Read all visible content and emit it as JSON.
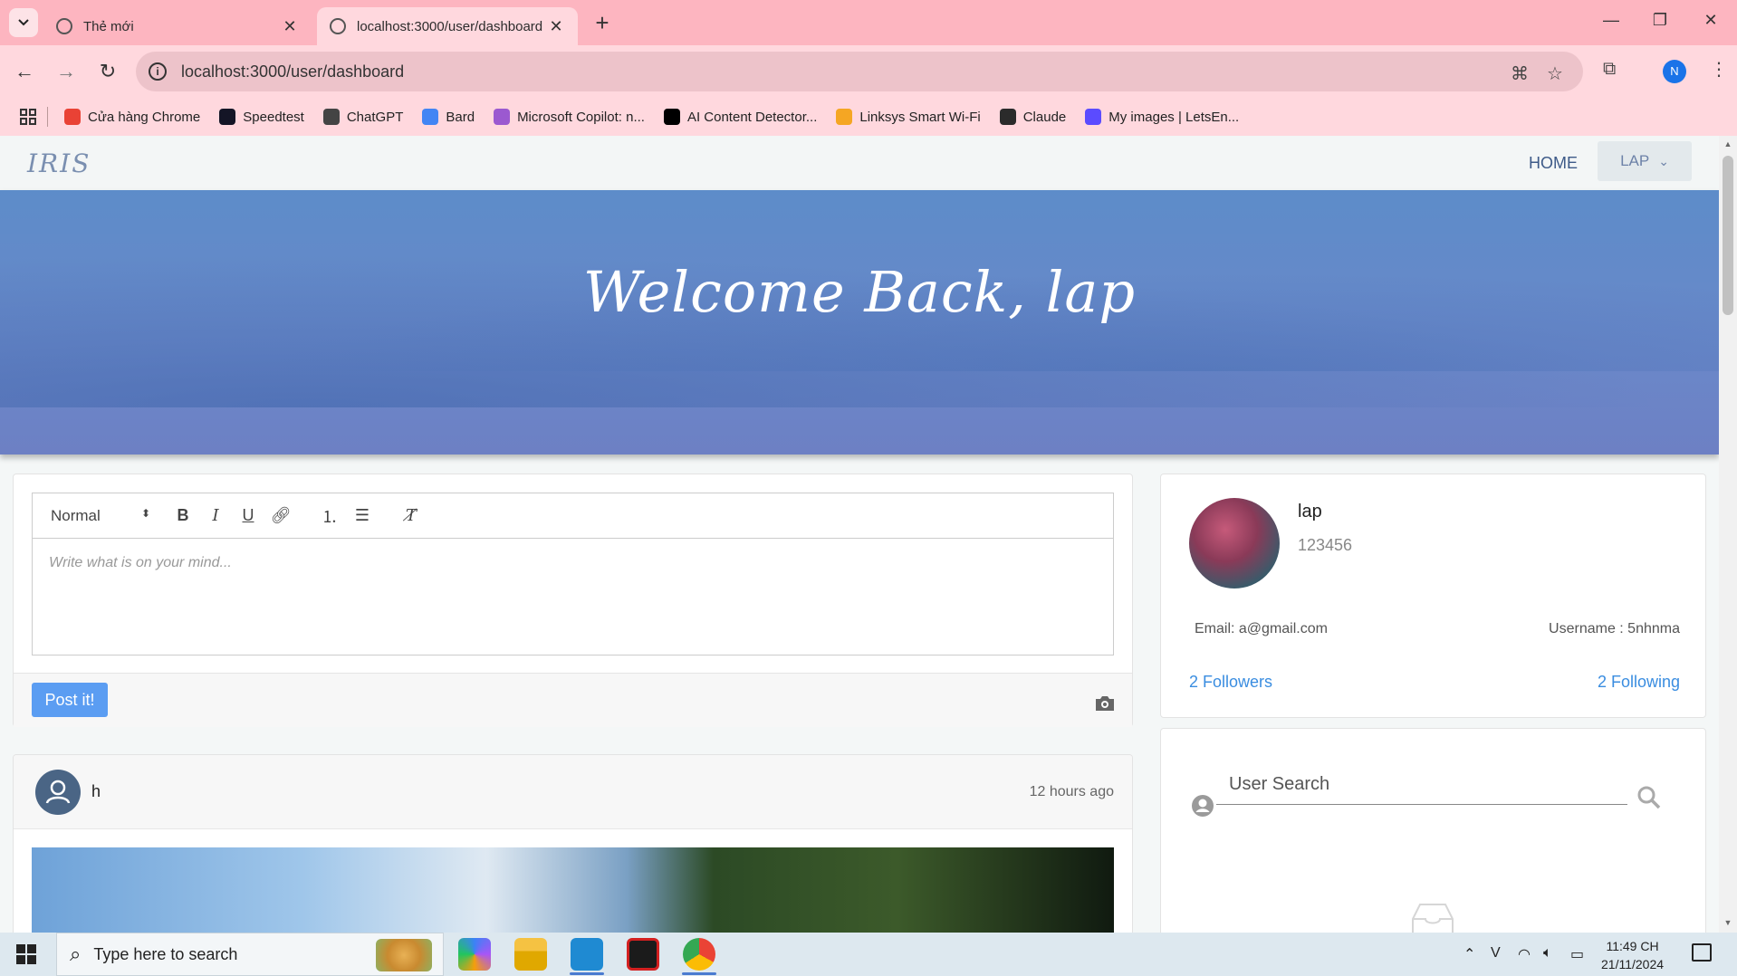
{
  "browser": {
    "tabs": [
      {
        "title": "Thẻ mới",
        "active": false
      },
      {
        "title": "localhost:3000/user/dashboard",
        "active": true
      }
    ],
    "url": "localhost:3000/user/dashboard",
    "profile_initial": "N",
    "bookmarks": [
      {
        "label": "Cửa hàng Chrome",
        "icon": "chrome-store-icon",
        "color": "#e94235"
      },
      {
        "label": "Speedtest",
        "icon": "speedtest-icon",
        "color": "#141526"
      },
      {
        "label": "ChatGPT",
        "icon": "chatgpt-icon",
        "color": "#444444"
      },
      {
        "label": "Bard",
        "icon": "bard-icon",
        "color": "#4285f4"
      },
      {
        "label": "Microsoft Copilot: n...",
        "icon": "copilot-icon",
        "color": "#9b59d0"
      },
      {
        "label": "AI Content Detector...",
        "icon": "ai-detector-icon",
        "color": "#000000"
      },
      {
        "label": "Linksys Smart Wi-Fi",
        "icon": "linksys-icon",
        "color": "#f5a623"
      },
      {
        "label": "Claude",
        "icon": "claude-icon",
        "color": "#2b2b2b"
      },
      {
        "label": "My images | LetsEn...",
        "icon": "letsenhance-icon",
        "color": "#5b4bff"
      }
    ]
  },
  "site": {
    "brand": "IRIS",
    "nav_home": "HOME",
    "nav_user": "LAP",
    "welcome": "Welcome Back, lap"
  },
  "editor": {
    "format_select": "Normal",
    "placeholder": "Write what is on your mind...",
    "post_button": "Post it!"
  },
  "post": {
    "author": "h",
    "time": "12 hours ago"
  },
  "profile": {
    "name": "lap",
    "id": "123456",
    "email": "Email: a@gmail.com",
    "username": "Username : 5nhnma",
    "followers": "2 Followers",
    "following": "2 Following"
  },
  "search": {
    "placeholder": "User Search"
  },
  "taskbar": {
    "search_placeholder": "Type here to search",
    "time": "11:49 CH",
    "date": "21/11/2024"
  },
  "colors": {
    "accent": "#3a8de0",
    "post_button": "#5b9df2",
    "hero": "#6a88c9",
    "tabbar": "#fdb5c0"
  }
}
